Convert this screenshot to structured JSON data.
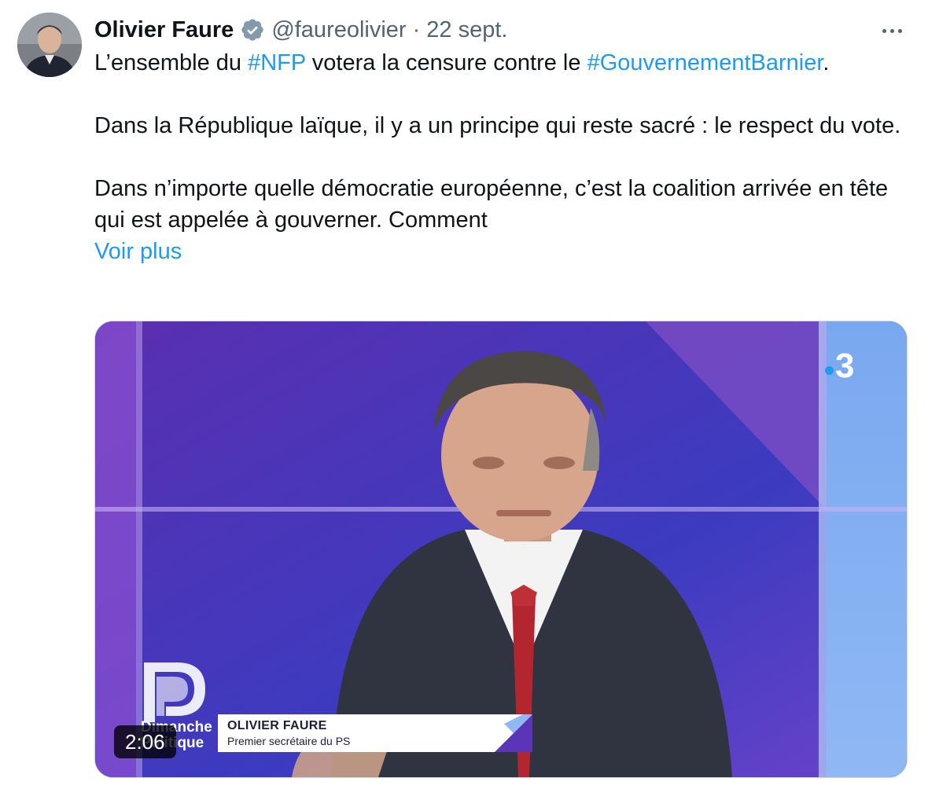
{
  "author": {
    "display_name": "Olivier Faure",
    "handle": "@faureolivier",
    "separator": "·",
    "date": "22 sept."
  },
  "icons": {
    "verified": "verified-badge-icon",
    "more": "more-options-icon"
  },
  "tweet": {
    "line1_prefix": "L’ensemble du ",
    "hashtag1": "#NFP",
    "line1_mid": " votera la censure contre le ",
    "hashtag2": "#GouvernementBarnier",
    "line1_suffix": ".",
    "paragraph2": "Dans la République laïque, il y a un principe qui reste sacré : le respect du vote.",
    "paragraph3": "Dans n’importe quelle démocratie européenne, c’est la coalition arrivée en tête qui est appelée à gouverner. Comment",
    "show_more": "Voir plus"
  },
  "media": {
    "channel_logo": "3",
    "show_name_line1": "Dimanche",
    "show_name_line2": "Politique",
    "lower_third_name": "OLIVIER FAURE",
    "lower_third_title": "Premier secrétaire du PS",
    "duration": "2:06"
  },
  "colors": {
    "link": "#1d9bf0",
    "text": "#0f1419",
    "muted": "#536471",
    "verified": "#829aab"
  }
}
